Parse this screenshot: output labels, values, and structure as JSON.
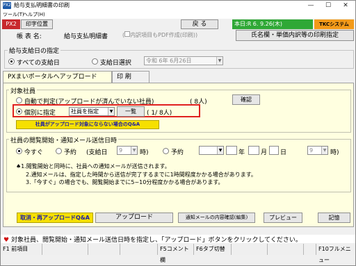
{
  "window": {
    "title": "給与支払明細書の印刷",
    "icon_text": "PX2"
  },
  "menu": {
    "items": [
      "ツール(T)",
      "ヘルプ(H)"
    ]
  },
  "toolbar": {
    "px2_label": "PX2",
    "print_position_label": "印字位置",
    "back_label": "戻 る",
    "today_label": "本日:R 6. 9.26(木)",
    "tkc_label": "TKCシステムQ&A"
  },
  "form": {
    "label": "帳 表 名:",
    "name": "給与支払明細書",
    "pdf_option": "内訳項目もPDF作成(印刷)",
    "name_settings_button": "氏名欄・単価内訳等の印刷指定"
  },
  "pay_date": {
    "group_title": "給与支給日の指定",
    "option_all": "すべての支給日",
    "option_select": "支給日選択",
    "select_value": "令和 6年 6月26日"
  },
  "tabs": [
    {
      "label": "PXまいポータルへアップロード",
      "active": true
    },
    {
      "label": "印 刷",
      "active": false
    }
  ],
  "target": {
    "group_title": "対象社員",
    "auto_label": "自動で判定(アップロードが済んでいない社員)",
    "auto_count": "( 8人)",
    "confirm_button": "確認",
    "individual_label": "個別に指定",
    "employee_select": "社員を指定",
    "list_button": "一覧",
    "individual_count": "( 1/ 8人)",
    "faq_button": "社員がアップロード対象にならない場合のQ&A"
  },
  "schedule": {
    "group_title": "社員の閲覧開始・通知メール送信日時",
    "now_label": "今すぐ",
    "reserve1_label": "予約",
    "payday_label": "(支給日",
    "payday_hour": "9",
    "hour_suffix": "時)",
    "reserve2_label": "予約",
    "year_suffix": "年",
    "month_suffix": "月",
    "day_suffix": "日",
    "hour2": "9",
    "hour2_suffix": "時)",
    "note_head": "♠1.",
    "notes": [
      "♠1.閲覧開始と同時に、社員への通知メールが送信されます。",
      "2.通知メールは、指定した時間から送信が完了するまでに1時間程度かかる場合があります。",
      "3.「今すぐ」の場合でも、閲覧開始までに5~10分程度かかる場合があります。"
    ]
  },
  "actions": {
    "cancel_reupload_faq": "取消・再アップロードQ&A",
    "upload": "アップロード",
    "mail_confirm": "通知メールの内容確認(編集)",
    "preview": "プレビュー",
    "record": "記憶"
  },
  "status_message": "対象社員、閲覧開始・通知メール送信日時を指定し、「アップロード」ボタンをクリックしてください。",
  "fkeys": [
    {
      "key": "F1",
      "label": "前項目"
    },
    {
      "key": "F5",
      "label": "コメント欄"
    },
    {
      "key": "F6",
      "label": "タブ切替"
    },
    {
      "key": "F10",
      "label": "フルメニュー"
    }
  ],
  "colors": {
    "px2_red": "#c8282d",
    "today_green": "#2fa836",
    "tkc_orange": "#f39a19",
    "panel_yellow": "#ffffe0",
    "highlight_red": "#e02020",
    "faq_yellow": "#f6e000"
  }
}
